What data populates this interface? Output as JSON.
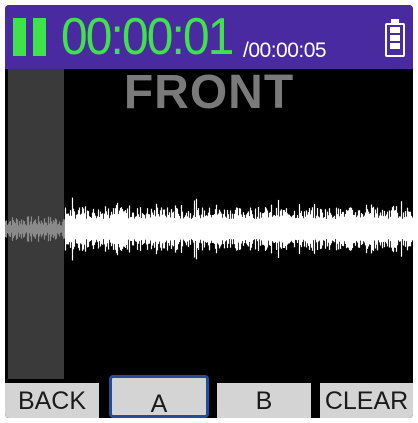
{
  "header": {
    "elapsed_time": "00:00:01",
    "total_time": "/00:00:05",
    "play_icon": "play-status-icon",
    "battery_icon": "battery-icon",
    "accent_color": "#3fe24a",
    "background_color": "#4a2aa0"
  },
  "waveform": {
    "channel_label": "FRONT",
    "playback_position": 0.2
  },
  "footer": {
    "buttons": [
      {
        "label": "BACK"
      },
      {
        "label": "A",
        "selected": true
      },
      {
        "label": "B"
      },
      {
        "label": "CLEAR"
      }
    ]
  }
}
